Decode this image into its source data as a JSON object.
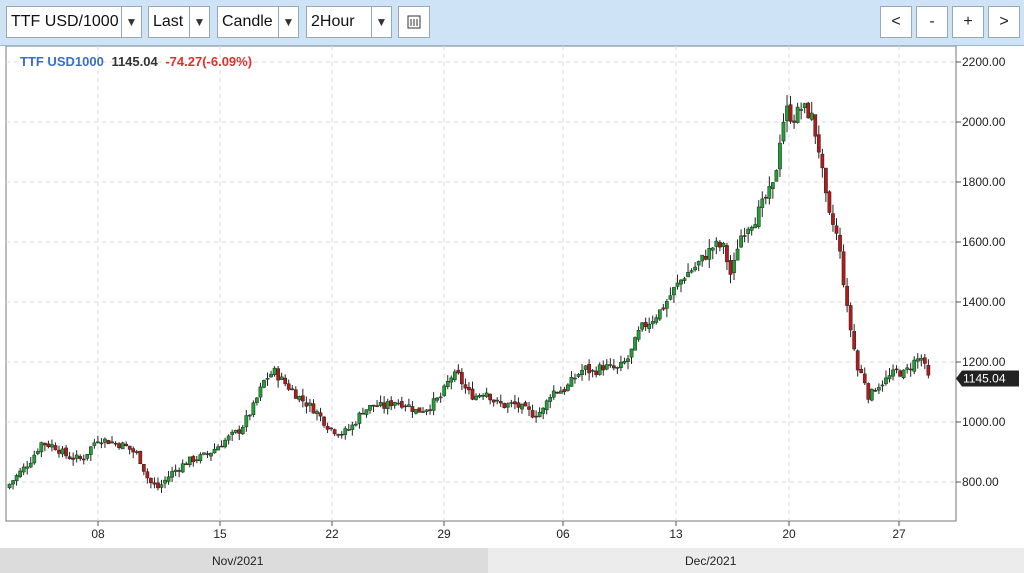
{
  "toolbar": {
    "symbol": "TTF USD/1000",
    "price_type": "Last",
    "chart_type": "Candle",
    "interval": "2Hour",
    "buttons": {
      "prev": "<",
      "zoom_out": "-",
      "zoom_in": "+",
      "next": ">"
    }
  },
  "header": {
    "symbol": "TTF USD1000",
    "last": "1145.04",
    "change": "-74.27(-6.09%)",
    "symbol_color": "#3a6fc4",
    "change_color": "#e0302a"
  },
  "chart_data": {
    "type": "candlestick",
    "title": "",
    "xlabel": "",
    "ylabel": "",
    "ylim": [
      730,
      2230
    ],
    "y_ticks": [
      "800.00",
      "1000.00",
      "1200.00",
      "1400.00",
      "1600.00",
      "1800.00",
      "2000.00",
      "2200.00"
    ],
    "x_ticks": [
      "08",
      "15",
      "22",
      "29",
      "06",
      "13",
      "20",
      "27"
    ],
    "period_labels": [
      "Nov/2021",
      "Dec/2021"
    ],
    "last_price_label": "1145.04",
    "up_color": "#1fa035",
    "down_color": "#b51a1a",
    "grid": true,
    "close_series": [
      [
        0,
        780
      ],
      [
        1.3,
        870
      ],
      [
        1.9,
        930
      ],
      [
        2.6,
        920
      ],
      [
        3.3,
        885
      ],
      [
        4.1,
        875
      ],
      [
        4.9,
        945
      ],
      [
        5.6,
        935
      ],
      [
        6.4,
        920
      ],
      [
        7.1,
        890
      ],
      [
        7.7,
        800
      ],
      [
        8.2,
        780
      ],
      [
        8.9,
        830
      ],
      [
        9.8,
        870
      ],
      [
        10.8,
        890
      ],
      [
        11.7,
        935
      ],
      [
        12.6,
        975
      ],
      [
        13.3,
        1050
      ],
      [
        13.9,
        1140
      ],
      [
        14.4,
        1170
      ],
      [
        14.9,
        1135
      ],
      [
        15.8,
        1080
      ],
      [
        16.6,
        1040
      ],
      [
        17.4,
        980
      ],
      [
        18.1,
        960
      ],
      [
        18.6,
        985
      ],
      [
        19.2,
        1040
      ],
      [
        19.8,
        1055
      ],
      [
        20.3,
        1050
      ],
      [
        20.9,
        1070
      ],
      [
        21.5,
        1060
      ],
      [
        22.1,
        1035
      ],
      [
        22.7,
        1050
      ],
      [
        23.4,
        1085
      ],
      [
        23.9,
        1150
      ],
      [
        24.3,
        1155
      ],
      [
        24.8,
        1100
      ],
      [
        25.2,
        1085
      ],
      [
        25.8,
        1105
      ],
      [
        26.3,
        1065
      ],
      [
        26.8,
        1055
      ],
      [
        27.3,
        1060
      ],
      [
        27.9,
        1040
      ],
      [
        28.4,
        1025
      ],
      [
        28.9,
        1040
      ],
      [
        29.3,
        1100
      ],
      [
        30.1,
        1110
      ],
      [
        30.6,
        1150
      ],
      [
        31.1,
        1180
      ],
      [
        31.5,
        1165
      ],
      [
        32.1,
        1185
      ],
      [
        32.9,
        1175
      ],
      [
        33.5,
        1215
      ],
      [
        34.1,
        1310
      ],
      [
        34.7,
        1340
      ],
      [
        35.3,
        1380
      ],
      [
        35.9,
        1440
      ],
      [
        36.5,
        1490
      ],
      [
        37.1,
        1520
      ],
      [
        37.6,
        1555
      ],
      [
        38.1,
        1590
      ],
      [
        38.6,
        1580
      ],
      [
        39.0,
        1480
      ],
      [
        39.4,
        1610
      ],
      [
        39.8,
        1650
      ],
      [
        40.3,
        1680
      ],
      [
        40.8,
        1740
      ],
      [
        41.3,
        1790
      ],
      [
        41.7,
        1990
      ],
      [
        42.0,
        2040
      ],
      [
        42.3,
        2010
      ],
      [
        42.8,
        2050
      ],
      [
        43.3,
        2020
      ],
      [
        43.7,
        1910
      ],
      [
        44.2,
        1690
      ],
      [
        44.6,
        1640
      ],
      [
        44.9,
        1540
      ],
      [
        45.2,
        1380
      ],
      [
        45.5,
        1280
      ],
      [
        45.8,
        1170
      ],
      [
        46.1,
        1155
      ],
      [
        46.4,
        1080
      ],
      [
        46.8,
        1120
      ],
      [
        47.3,
        1140
      ],
      [
        47.9,
        1170
      ],
      [
        48.3,
        1160
      ],
      [
        48.8,
        1200
      ],
      [
        49.2,
        1215
      ],
      [
        49.6,
        1145
      ]
    ]
  }
}
